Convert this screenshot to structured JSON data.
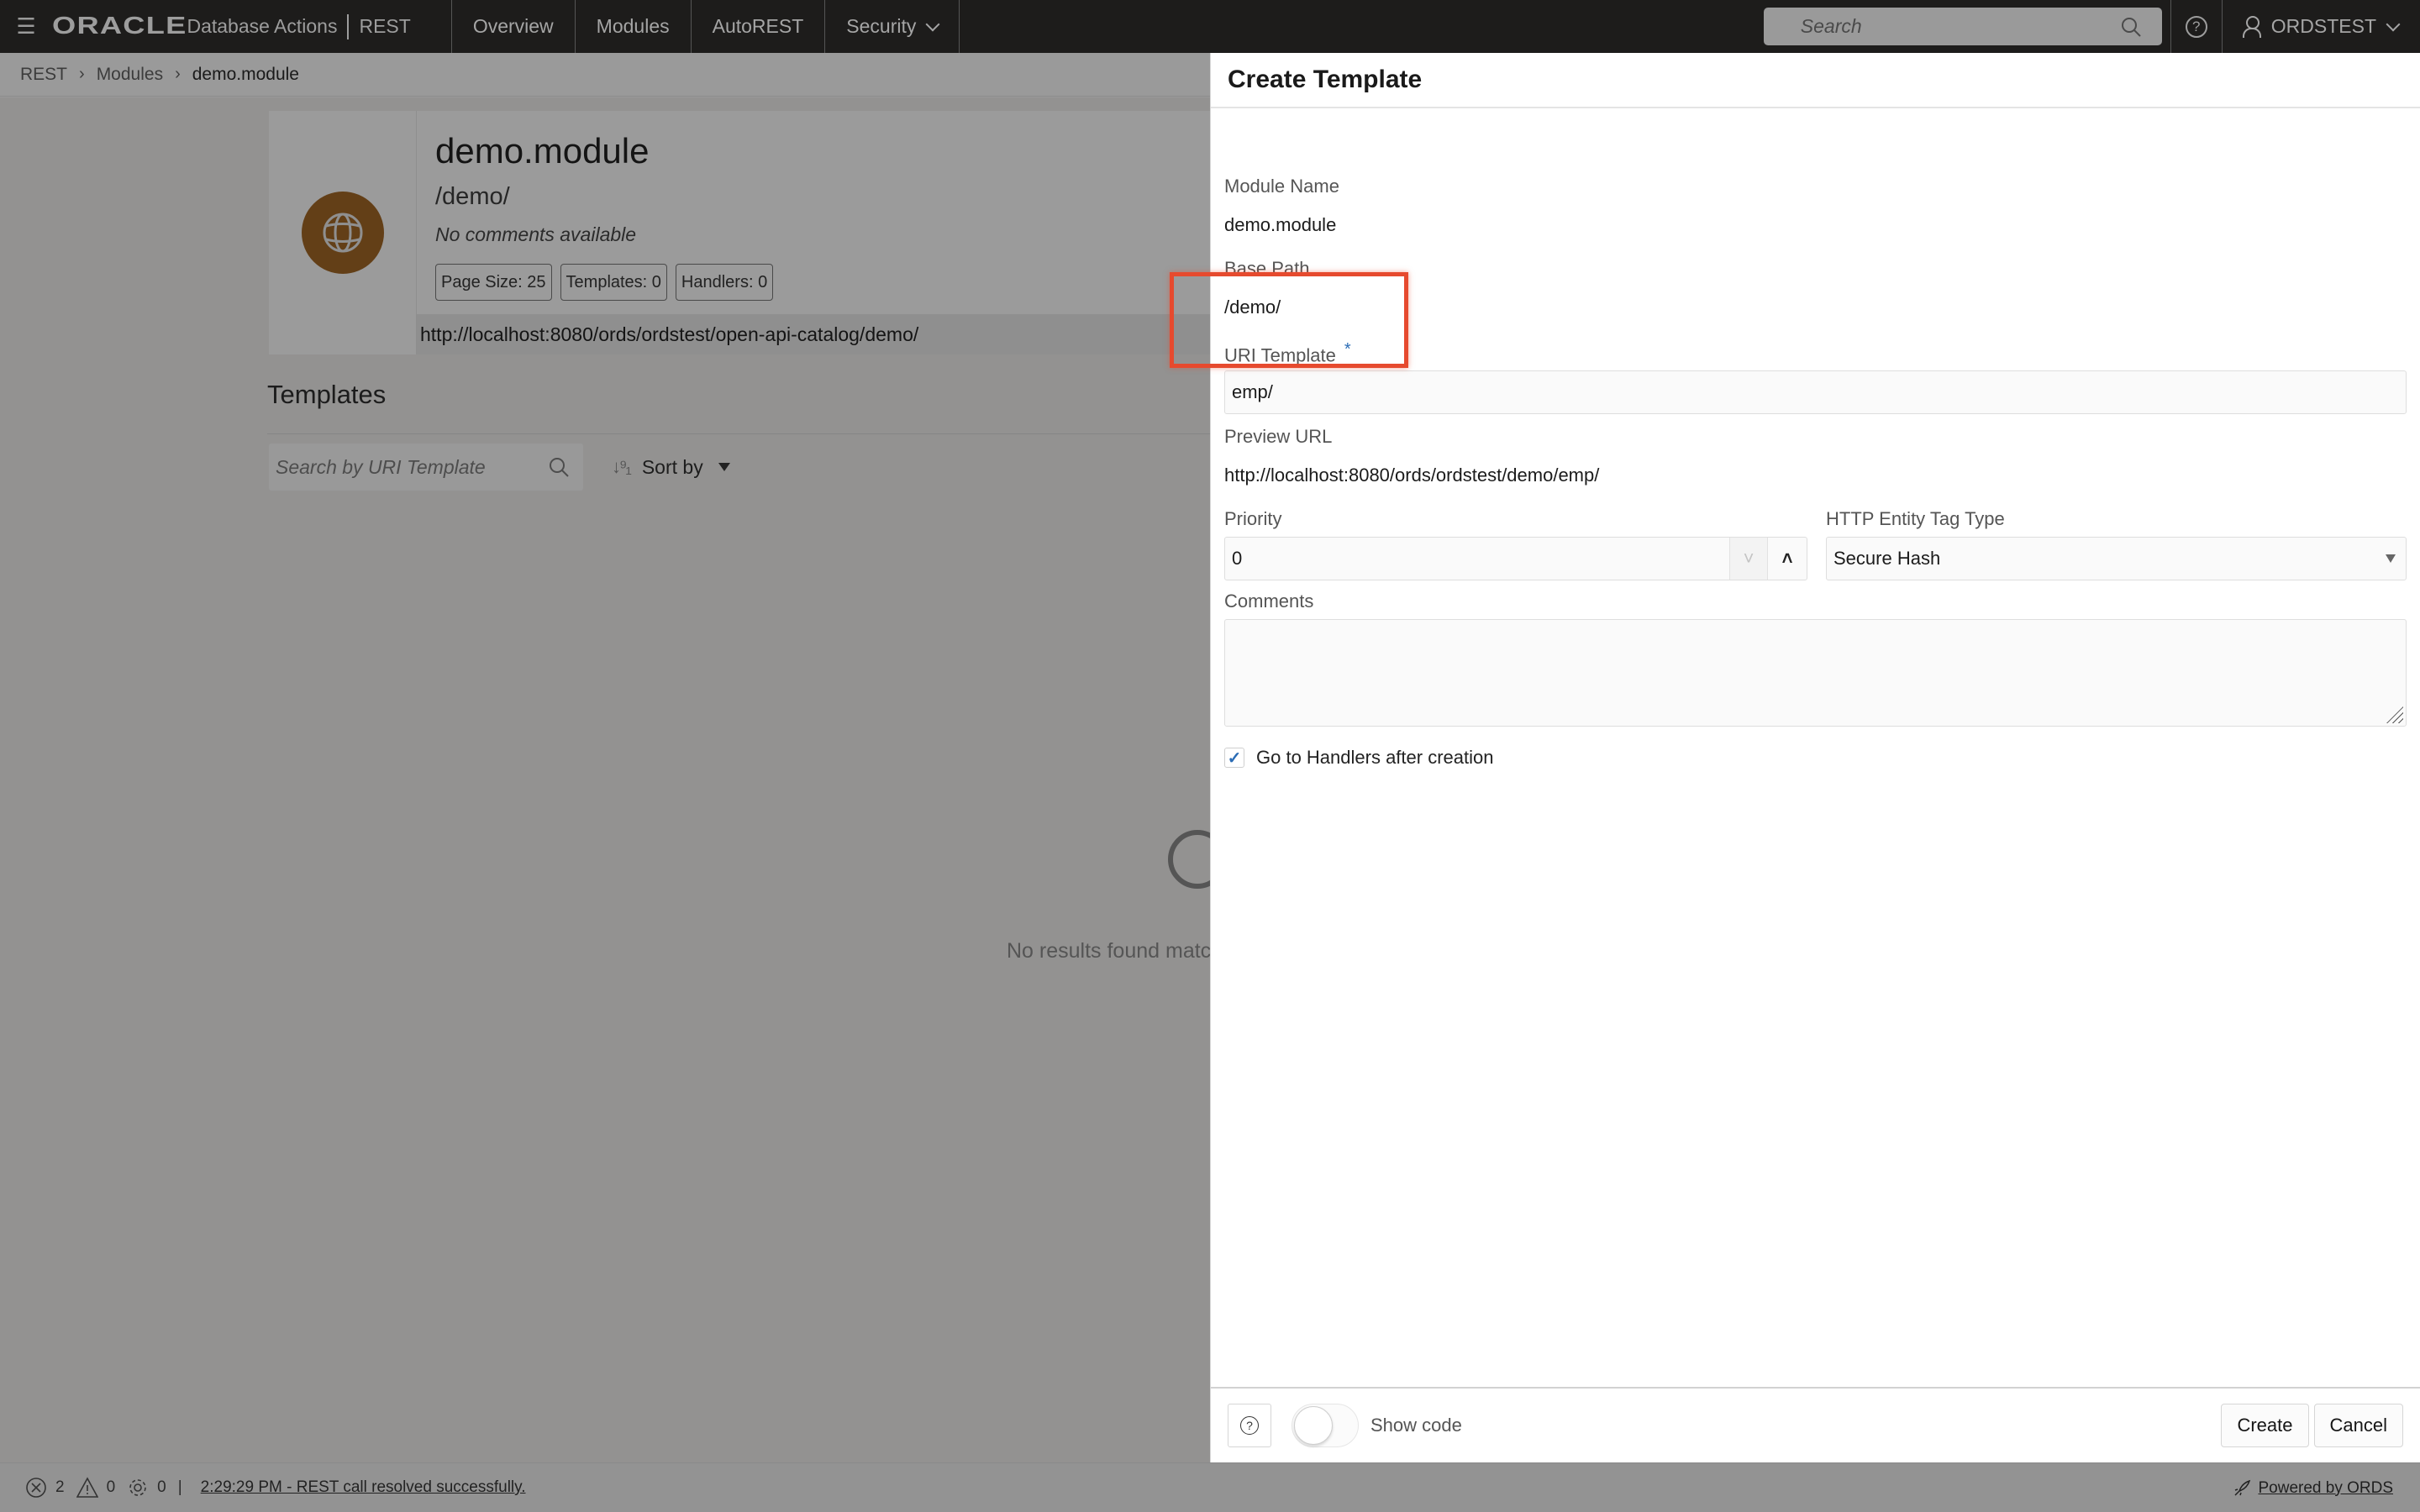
{
  "topbar": {
    "brand": "ORACLE",
    "app_name": "Database Actions",
    "section": "REST",
    "nav": [
      {
        "label": "Overview"
      },
      {
        "label": "Modules"
      },
      {
        "label": "AutoREST"
      },
      {
        "label": "Security",
        "has_dropdown": true
      }
    ],
    "search_placeholder": "Search",
    "user": "ORDSTEST"
  },
  "breadcrumb": [
    "REST",
    "Modules",
    "demo.module"
  ],
  "module": {
    "name": "demo.module",
    "base_path": "/demo/",
    "comment": "No comments available",
    "chips": [
      "Page Size: 25",
      "Templates: 0",
      "Handlers: 0"
    ],
    "url": "http://localhost:8080/ords/ordstest/open-api-catalog/demo/",
    "icon": "globe-icon",
    "icon_color": "#633f17"
  },
  "templates": {
    "title": "Templates",
    "search_placeholder": "Search by URI Template",
    "sort_label": "Sort by",
    "empty_message": "No results found match"
  },
  "drawer": {
    "title": "Create Template",
    "module_name_label": "Module Name",
    "module_name_value": "demo.module",
    "base_path_label": "Base Path",
    "base_path_value": "/demo/",
    "uri_template_label": "URI Template",
    "uri_template_required": "*",
    "uri_template_value": "emp/",
    "preview_url_label": "Preview URL",
    "preview_url_value": "http://localhost:8080/ords/ordstest/demo/emp/",
    "priority_label": "Priority",
    "priority_value": "0",
    "etag_label": "HTTP Entity Tag Type",
    "etag_value": "Secure Hash",
    "comments_label": "Comments",
    "comments_value": "",
    "go_to_handlers_label": "Go to Handlers after creation",
    "go_to_handlers_checked": true,
    "show_code_label": "Show code",
    "show_code_on": false,
    "create_label": "Create",
    "cancel_label": "Cancel"
  },
  "statusbar": {
    "errors": "2",
    "warnings": "0",
    "settings": "0",
    "separator": "|",
    "message": "2:29:29 PM - REST call resolved successfully.",
    "powered_by": "Powered by ORDS"
  },
  "colors": {
    "accent_blue": "#2b6cb5",
    "highlight_red": "#e64a2e",
    "topbar_bg": "#1d1c1b"
  }
}
